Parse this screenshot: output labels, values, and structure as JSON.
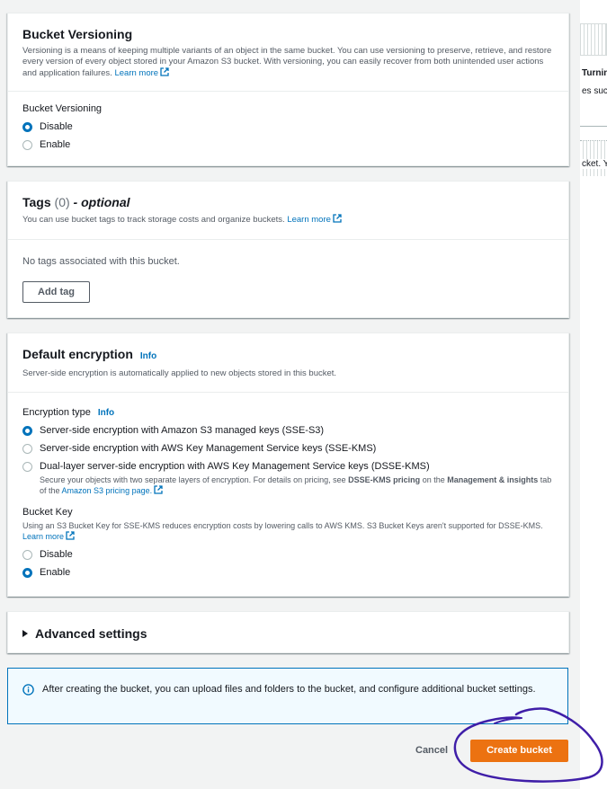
{
  "versioning": {
    "title": "Bucket Versioning",
    "description": "Versioning is a means of keeping multiple variants of an object in the same bucket. You can use versioning to preserve, retrieve, and restore every version of every object stored in your Amazon S3 bucket. With versioning, you can easily recover from both unintended user actions and application failures.",
    "learn_more": "Learn more",
    "field_label": "Bucket Versioning",
    "options": [
      {
        "label": "Disable",
        "selected": true
      },
      {
        "label": "Enable",
        "selected": false
      }
    ]
  },
  "tags": {
    "title": "Tags",
    "count": "(0)",
    "optional": "- optional",
    "description": "You can use bucket tags to track storage costs and organize buckets.",
    "learn_more": "Learn more",
    "empty_text": "No tags associated with this bucket.",
    "add_button": "Add tag"
  },
  "encryption": {
    "title": "Default encryption",
    "info": "Info",
    "description": "Server-side encryption is automatically applied to new objects stored in this bucket.",
    "type_label": "Encryption type",
    "type_info": "Info",
    "options": [
      {
        "label": "Server-side encryption with Amazon S3 managed keys (SSE-S3)",
        "selected": true
      },
      {
        "label": "Server-side encryption with AWS Key Management Service keys (SSE-KMS)",
        "selected": false
      },
      {
        "label": "Dual-layer server-side encryption with AWS Key Management Service keys (DSSE-KMS)",
        "selected": false
      }
    ],
    "dsse_note_1": "Secure your objects with two separate layers of encryption. For details on pricing, see ",
    "dsse_note_bold1": "DSSE-KMS pricing",
    "dsse_note_2": " on the ",
    "dsse_note_bold2": "Management & insights",
    "dsse_note_3": " tab of the ",
    "dsse_note_link": "Amazon S3 pricing page.",
    "bucket_key_label": "Bucket Key",
    "bucket_key_desc": "Using an S3 Bucket Key for SSE-KMS reduces encryption costs by lowering calls to AWS KMS. S3 Bucket Keys aren't supported for DSSE-KMS.",
    "bucket_key_learn_more": "Learn more",
    "bucket_key_options": [
      {
        "label": "Disable",
        "selected": false
      },
      {
        "label": "Enable",
        "selected": true
      }
    ]
  },
  "advanced": {
    "title": "Advanced settings"
  },
  "alert": {
    "text": "After creating the bucket, you can upload files and folders to the bucket, and configure additional bucket settings."
  },
  "actions": {
    "cancel": "Cancel",
    "create": "Create bucket"
  },
  "right_strip": {
    "text_1": "Turnin",
    "text_2": "es suc",
    "text_3": "cket. Yo"
  },
  "colors": {
    "accent": "#0073bb",
    "primary_button": "#ec7211",
    "annotation": "#3f1ea8"
  }
}
